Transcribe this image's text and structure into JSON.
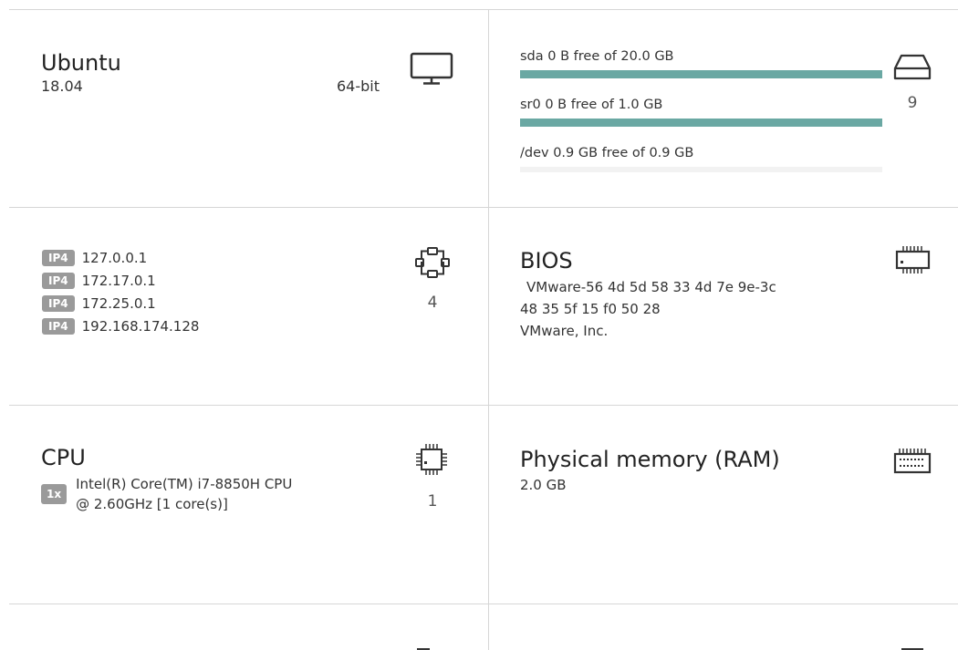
{
  "os": {
    "name": "Ubuntu",
    "version": "18.04",
    "arch": "64-bit"
  },
  "disks": {
    "count": "9",
    "items": [
      {
        "label": "sda 0 B free of 20.0 GB",
        "used_fraction": 1.0
      },
      {
        "label": "sr0 0 B free of 1.0 GB",
        "used_fraction": 1.0
      },
      {
        "label": "/dev 0.9 GB free of 0.9 GB",
        "used_fraction": 0.0
      }
    ]
  },
  "network": {
    "count": "4",
    "addresses": [
      {
        "badge": "IP4",
        "ip": "127.0.0.1"
      },
      {
        "badge": "IP4",
        "ip": "172.17.0.1"
      },
      {
        "badge": "IP4",
        "ip": "172.25.0.1"
      },
      {
        "badge": "IP4",
        "ip": "192.168.174.128"
      }
    ]
  },
  "bios": {
    "title": "BIOS",
    "serial_line1": "VMware-56 4d 5d 58 33 4d 7e 9e-3c",
    "serial_line2": "48 35 5f 15 f0 50 28",
    "vendor": "VMware, Inc."
  },
  "cpu": {
    "title": "CPU",
    "count": "1",
    "badge": "1x",
    "line1": "Intel(R) Core(TM) i7-8850H CPU",
    "line2": "@ 2.60GHz [1 core(s)]"
  },
  "ram": {
    "title": "Physical memory (RAM)",
    "value": "2.0 GB"
  },
  "icons": {
    "os": "monitor-icon",
    "disks": "hard-drive-icon",
    "network": "network-icon",
    "bios": "bios-chip-icon",
    "cpu": "cpu-icon",
    "ram": "memory-icon"
  },
  "colors": {
    "bar_fill": "#6aa8a3",
    "badge_bg": "#9a9a9a"
  }
}
